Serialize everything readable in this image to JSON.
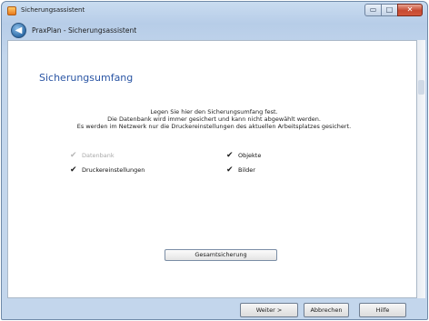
{
  "window": {
    "title": "Sicherungsassistent",
    "controls": {
      "minimize": "▭",
      "maximize": "□",
      "close": "✕"
    }
  },
  "header": {
    "back_icon": "back-arrow-icon",
    "back_glyph": "◀",
    "title": "PraxPlan - Sicherungsassistent"
  },
  "main": {
    "section_title": "Sicherungsumfang",
    "description": [
      "Legen Sie hier den Sicherungsumfang fest.",
      "Die Datenbank wird immer gesichert und kann nicht abgewählt werden.",
      "Es werden im Netzwerk nur die  Druckereinstellungen des aktuellen Arbeitsplatzes gesichert."
    ],
    "options": [
      {
        "label": "Datenbank",
        "checked": true,
        "disabled": true
      },
      {
        "label": "Objekte",
        "checked": true,
        "disabled": false
      },
      {
        "label": "Druckereinstellungen",
        "checked": true,
        "disabled": false
      },
      {
        "label": "Bilder",
        "checked": true,
        "disabled": false
      }
    ],
    "check_glyph": "✔",
    "full_backup_label": "Gesamtsicherung"
  },
  "footer": {
    "next_label": "Weiter >",
    "cancel_label": "Abbrechen",
    "help_label": "Hilfe"
  },
  "colors": {
    "section_title": "#2a55a4",
    "chrome": "#b7cde8",
    "close_button": "#c74a31"
  }
}
